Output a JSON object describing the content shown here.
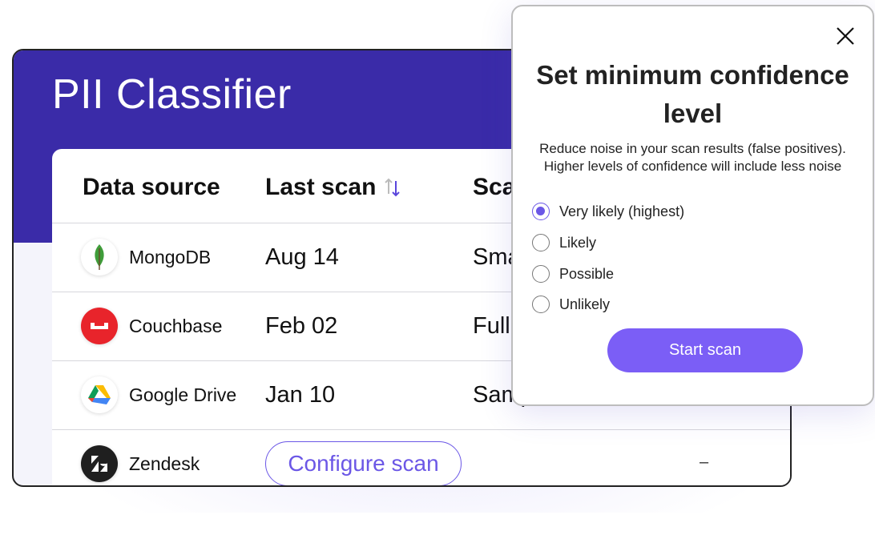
{
  "app": {
    "title": "PII Classifier"
  },
  "table": {
    "columns": {
      "source": "Data source",
      "last_scan": "Last scan",
      "scan_type": "Sca"
    },
    "rows": [
      {
        "source": "MongoDB",
        "last_scan": "Aug 14",
        "scan_type": "Sma",
        "logo": "mongodb-leaf-icon"
      },
      {
        "source": "Couchbase",
        "last_scan": "Feb 02",
        "scan_type": "Full",
        "logo": "couchbase-icon"
      },
      {
        "source": "Google Drive",
        "last_scan": "Jan 10",
        "scan_type": "Samp",
        "logo": "google-drive-icon"
      },
      {
        "source": "Zendesk",
        "action": "Configure scan",
        "scan_type": "–",
        "logo": "zendesk-icon"
      }
    ]
  },
  "modal": {
    "title": "Set minimum confidence level",
    "description_line1": "Reduce noise in your scan results (false positives).",
    "description_line2": "Higher levels of confidence will include less noise",
    "options": [
      {
        "label": "Very likely (highest)",
        "checked": true
      },
      {
        "label": "Likely",
        "checked": false
      },
      {
        "label": "Possible",
        "checked": false
      },
      {
        "label": "Unlikely",
        "checked": false
      }
    ],
    "submit_label": "Start scan"
  },
  "colors": {
    "header": "#3a2ba8",
    "accent": "#7b5ef6"
  }
}
